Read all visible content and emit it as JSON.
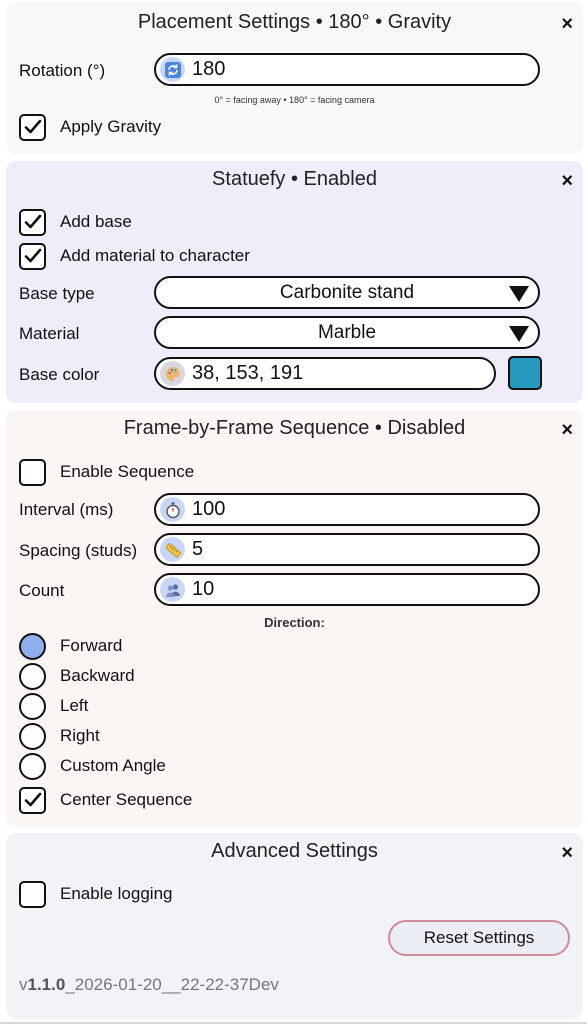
{
  "placement": {
    "title": "Placement Settings • 180° • Gravity",
    "close": "×",
    "rotation_label": "Rotation (°)",
    "rotation_icon": "rotate-icon",
    "rotation_value": "180",
    "rotation_hint": "0° = facing away • 180° = facing camera",
    "gravity_label": "Apply Gravity",
    "gravity_checked": true
  },
  "statuefy": {
    "title": "Statuefy • Enabled",
    "close": "×",
    "add_base_label": "Add base",
    "add_base_checked": true,
    "add_material_label": "Add material to character",
    "add_material_checked": true,
    "base_type_label": "Base type",
    "base_type_value": "Carbonite stand",
    "material_label": "Material",
    "material_value": "Marble",
    "base_color_label": "Base color",
    "base_color_icon": "palette-icon",
    "base_color_value": "38, 153, 191",
    "base_color_hex": "#2699bf"
  },
  "frame": {
    "title": "Frame-by-Frame Sequence • Disabled",
    "close": "×",
    "enable_label": "Enable Sequence",
    "enable_checked": false,
    "interval_label": "Interval (ms)",
    "interval_icon": "stopwatch-icon",
    "interval_value": "100",
    "spacing_label": "Spacing (studs)",
    "spacing_icon": "ruler-icon",
    "spacing_value": "5",
    "count_label": "Count",
    "count_icon": "people-icon",
    "count_value": "10",
    "direction_label": "Direction:",
    "directions": [
      "Forward",
      "Backward",
      "Left",
      "Right",
      "Custom Angle"
    ],
    "selected_direction": "Forward",
    "center_label": "Center Sequence",
    "center_checked": true
  },
  "advanced": {
    "title": "Advanced Settings",
    "close": "×",
    "logging_label": "Enable logging",
    "logging_checked": false,
    "reset_label": "Reset Settings",
    "version_prefix": "v",
    "version_number": "1.1.0",
    "version_suffix": "_2026-01-20__22-22-37Dev"
  },
  "colors": {
    "accent_radio": "#8fb0ec",
    "reset_border": "#d08aa0"
  }
}
